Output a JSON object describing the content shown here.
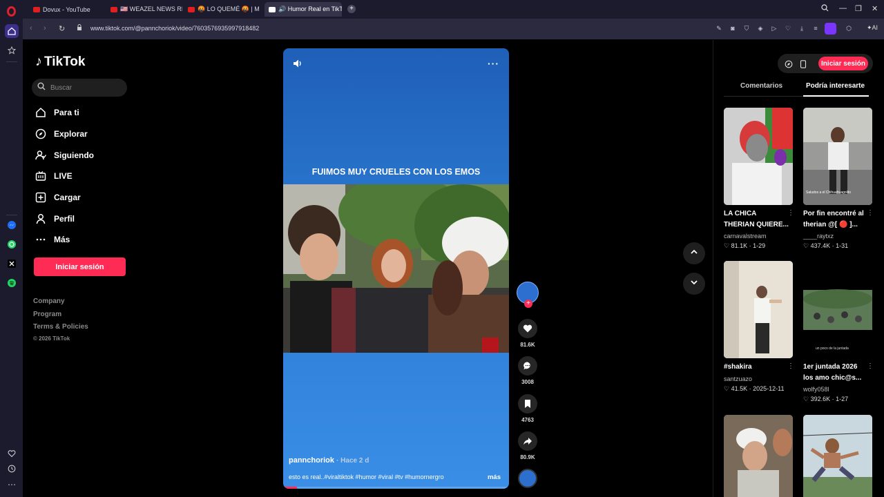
{
  "browser": {
    "tabs": [
      {
        "label": "Dovux - YouTube"
      },
      {
        "label": "🇺🇸 WEAZEL NEWS REP"
      },
      {
        "label": "🤬 LO QUEMÉ 🤬 | MEJO"
      },
      {
        "label": "🔊 Humor Real en TikTok"
      }
    ],
    "url": "www.tiktok.com/@pannchoriok/video/7603576935997918482",
    "ai_label": "AI"
  },
  "tiktok": {
    "logo_text": "TikTok",
    "search_placeholder": "Buscar",
    "nav": [
      {
        "label": "Para ti",
        "icon": "home-icon"
      },
      {
        "label": "Explorar",
        "icon": "compass-icon"
      },
      {
        "label": "Siguiendo",
        "icon": "following-icon"
      },
      {
        "label": "LIVE",
        "icon": "live-icon"
      },
      {
        "label": "Cargar",
        "icon": "upload-icon"
      },
      {
        "label": "Perfil",
        "icon": "profile-icon"
      },
      {
        "label": "Más",
        "icon": "more-icon"
      }
    ],
    "login_label": "Iniciar sesión",
    "footer": {
      "company": "Company",
      "program": "Program",
      "terms": "Terms & Policies",
      "copyright": "© 2026 TikTok"
    }
  },
  "video": {
    "overlay_text": "FUIMOS MUY CRUELES CON LOS EMOS",
    "author": "pannchoriok",
    "time": "· Hace 2 d",
    "description": "esto es real..#viraltiktok #humor #viral #tv #humornergro",
    "more_label": "más",
    "progress": 0.06
  },
  "actions": {
    "likes": "81.6K",
    "comments": "3008",
    "saves": "4763",
    "shares": "80.9K"
  },
  "right_panel": {
    "login_label": "Iniciar sesión",
    "tab_comments": "Comentarios",
    "tab_suggested": "Podría interesarte",
    "cards": [
      {
        "title1": "LA CHICA",
        "title2": "THERIAN QUIERE...",
        "user": "carnavalstream",
        "likes": "81.1K",
        "date": "1-29"
      },
      {
        "title1": "Por fin encontré al",
        "title2": "therian @[ 🔴 ]...",
        "user": "____raytxz",
        "likes": "437.4K",
        "date": "1-31"
      },
      {
        "title1": "#shakira",
        "title2": "",
        "user": "santzuazo",
        "likes": "41.5K",
        "date": "2025-12-11"
      },
      {
        "title1": "1er juntada 2026",
        "title2": "los amo chic@s...",
        "user": "wolfy058l",
        "likes": "392.6K",
        "date": "1-27"
      }
    ],
    "thumb_caption_2": "Saludos a el Chihuahuagolito",
    "thumb_caption_4": "un poco de la juntada"
  }
}
